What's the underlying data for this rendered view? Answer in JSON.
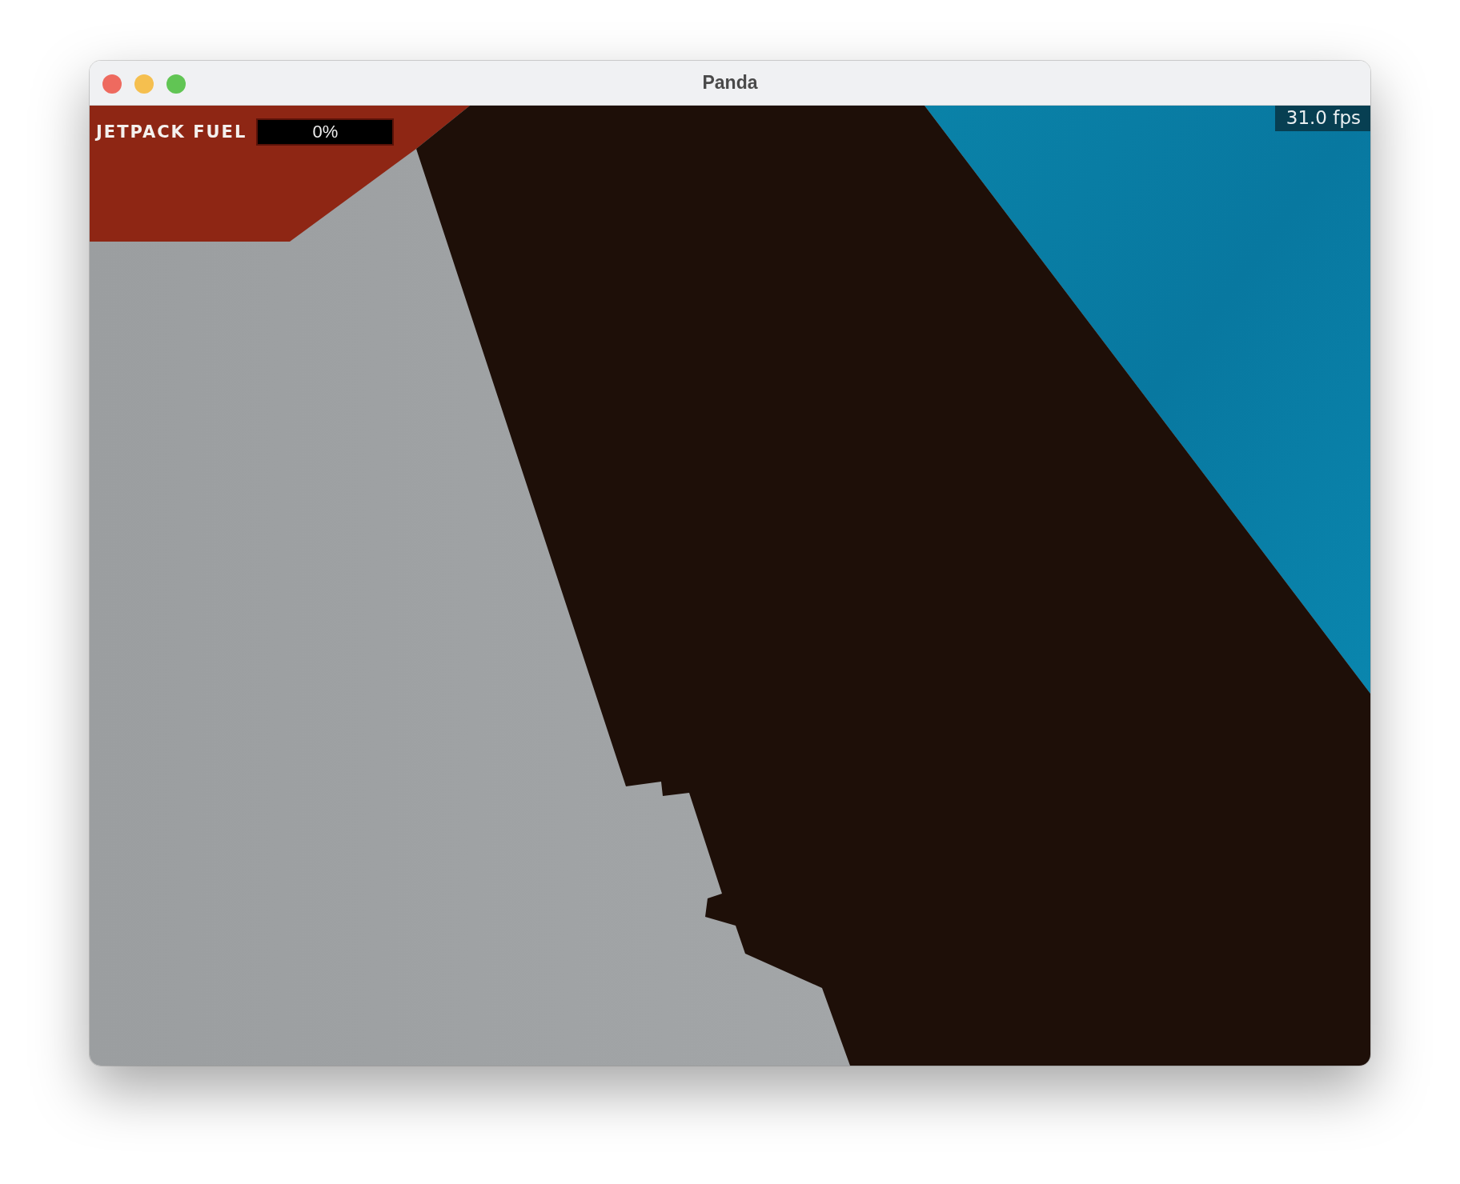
{
  "window": {
    "title": "Panda"
  },
  "hud": {
    "fuel_label": "JETPACK FUEL",
    "fuel_bar": {
      "reading": "0%"
    },
    "fps": "31.0 fps"
  }
}
